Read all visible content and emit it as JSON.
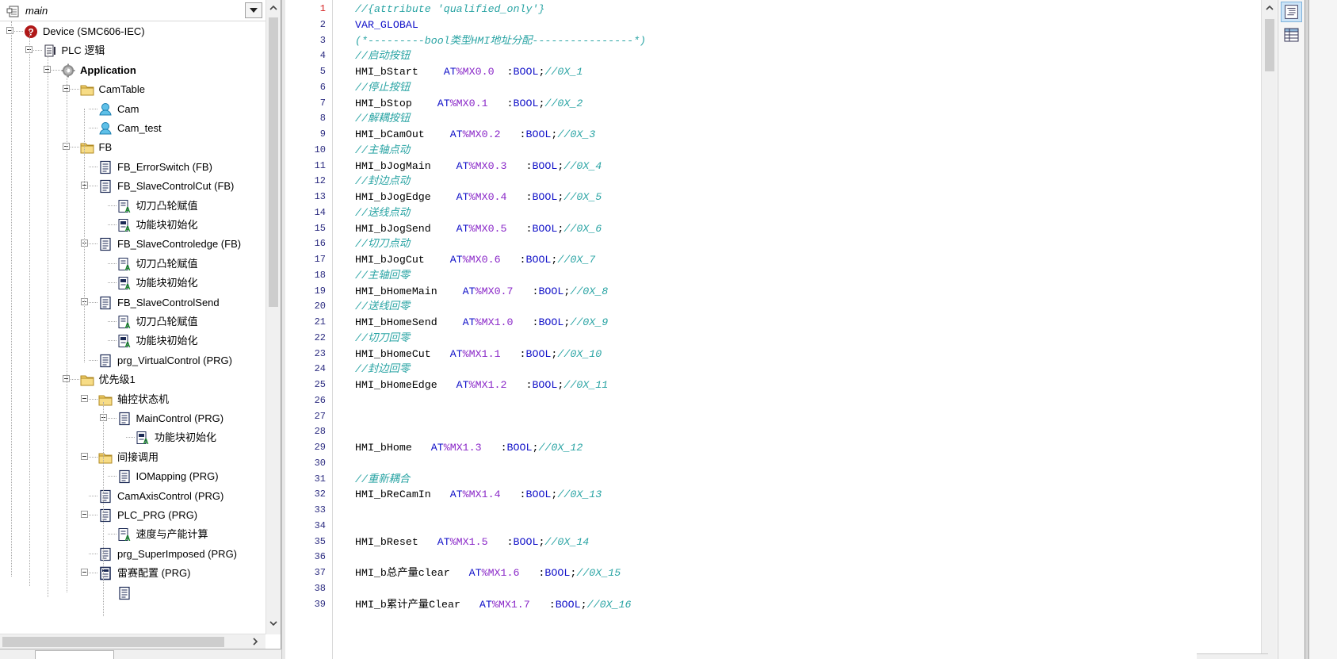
{
  "tree": {
    "root_label": "main",
    "nodes": [
      {
        "label": "Device (SMC606-IEC)",
        "icon": "device-error-icon",
        "expander": true,
        "bold": false
      },
      {
        "label": "PLC 逻辑",
        "icon": "plc-logic-icon",
        "expander": true,
        "bold": false
      },
      {
        "label": "Application",
        "icon": "application-gear-icon",
        "expander": true,
        "bold": true
      },
      {
        "label": "CamTable",
        "icon": "folder-icon",
        "expander": true,
        "bold": false
      },
      {
        "label": "Cam",
        "icon": "cam-icon",
        "expander": false,
        "bold": false
      },
      {
        "label": "Cam_test",
        "icon": "cam-icon",
        "expander": false,
        "bold": false
      },
      {
        "label": "FB",
        "icon": "folder-icon",
        "expander": true,
        "bold": false
      },
      {
        "label": "FB_ErrorSwitch (FB)",
        "icon": "pou-icon",
        "expander": false,
        "bold": false
      },
      {
        "label": "FB_SlaveControlCut (FB)",
        "icon": "pou-icon",
        "expander": true,
        "bold": false
      },
      {
        "label": "切刀凸轮赋值",
        "icon": "action-icon",
        "expander": false,
        "bold": false
      },
      {
        "label": "功能块初始化",
        "icon": "action-init-icon",
        "expander": false,
        "bold": false
      },
      {
        "label": "FB_SlaveControledge (FB)",
        "icon": "pou-icon",
        "expander": true,
        "bold": false
      },
      {
        "label": "切刀凸轮赋值",
        "icon": "action-icon",
        "expander": false,
        "bold": false
      },
      {
        "label": "功能块初始化",
        "icon": "action-init-icon",
        "expander": false,
        "bold": false
      },
      {
        "label": "FB_SlaveControlSend",
        "icon": "pou-icon",
        "expander": true,
        "bold": false
      },
      {
        "label": "切刀凸轮赋值",
        "icon": "action-icon",
        "expander": false,
        "bold": false
      },
      {
        "label": "功能块初始化",
        "icon": "action-init-icon",
        "expander": false,
        "bold": false
      },
      {
        "label": "prg_VirtualControl (PRG)",
        "icon": "pou-icon",
        "expander": false,
        "bold": false
      },
      {
        "label": "优先级1",
        "icon": "folder-icon",
        "expander": true,
        "bold": false
      },
      {
        "label": "轴控状态机",
        "icon": "folder-icon",
        "expander": true,
        "bold": false
      },
      {
        "label": "MainControl (PRG)",
        "icon": "pou-icon",
        "expander": true,
        "bold": false
      },
      {
        "label": "功能块初始化",
        "icon": "action-init-icon",
        "expander": false,
        "bold": false
      },
      {
        "label": "间接调用",
        "icon": "folder-icon",
        "expander": true,
        "bold": false
      },
      {
        "label": "IOMapping (PRG)",
        "icon": "pou-icon",
        "expander": false,
        "bold": false
      },
      {
        "label": "CamAxisControl (PRG)",
        "icon": "pou-icon",
        "expander": false,
        "bold": false
      },
      {
        "label": "PLC_PRG (PRG)",
        "icon": "pou-icon",
        "expander": true,
        "bold": false
      },
      {
        "label": "速度与产能计算",
        "icon": "action-icon",
        "expander": false,
        "bold": false
      },
      {
        "label": "prg_SuperImposed (PRG)",
        "icon": "pou-icon",
        "expander": false,
        "bold": false
      },
      {
        "label": "雷赛配置 (PRG)",
        "icon": "pou-dark-icon",
        "expander": true,
        "bold": false
      }
    ]
  },
  "editor": {
    "active_line": 1,
    "lines": [
      [
        {
          "t": "//{attribute 'qualified_only'}",
          "c": "cmt"
        }
      ],
      [
        {
          "t": "VAR_GLOBAL",
          "c": "kw"
        }
      ],
      [
        {
          "t": "(*---------bool类型HMI地址分配----------------*)",
          "c": "cmt"
        }
      ],
      [
        {
          "t": "//启动按钮",
          "c": "cmt"
        }
      ],
      [
        {
          "t": "HMI_bStart    ",
          "c": "id"
        },
        {
          "t": "AT",
          "c": "kw"
        },
        {
          "t": "%MX0.0",
          "c": "addr"
        },
        {
          "t": "  :",
          "c": "id"
        },
        {
          "t": "BOOL",
          "c": "type"
        },
        {
          "t": ";",
          "c": "id"
        },
        {
          "t": "//0X_1",
          "c": "cmt"
        }
      ],
      [
        {
          "t": "//停止按钮",
          "c": "cmt"
        }
      ],
      [
        {
          "t": "HMI_bStop    ",
          "c": "id"
        },
        {
          "t": "AT",
          "c": "kw"
        },
        {
          "t": "%MX0.1",
          "c": "addr"
        },
        {
          "t": "   :",
          "c": "id"
        },
        {
          "t": "BOOL",
          "c": "type"
        },
        {
          "t": ";",
          "c": "id"
        },
        {
          "t": "//0X_2",
          "c": "cmt"
        }
      ],
      [
        {
          "t": "//解耦按钮",
          "c": "cmt"
        }
      ],
      [
        {
          "t": "HMI_bCamOut    ",
          "c": "id"
        },
        {
          "t": "AT",
          "c": "kw"
        },
        {
          "t": "%MX0.2",
          "c": "addr"
        },
        {
          "t": "   :",
          "c": "id"
        },
        {
          "t": "BOOL",
          "c": "type"
        },
        {
          "t": ";",
          "c": "id"
        },
        {
          "t": "//0X_3",
          "c": "cmt"
        }
      ],
      [
        {
          "t": "//主轴点动",
          "c": "cmt"
        }
      ],
      [
        {
          "t": "HMI_bJogMain    ",
          "c": "id"
        },
        {
          "t": "AT",
          "c": "kw"
        },
        {
          "t": "%MX0.3",
          "c": "addr"
        },
        {
          "t": "   :",
          "c": "id"
        },
        {
          "t": "BOOL",
          "c": "type"
        },
        {
          "t": ";",
          "c": "id"
        },
        {
          "t": "//0X_4",
          "c": "cmt"
        }
      ],
      [
        {
          "t": "//封边点动",
          "c": "cmt"
        }
      ],
      [
        {
          "t": "HMI_bJogEdge    ",
          "c": "id"
        },
        {
          "t": "AT",
          "c": "kw"
        },
        {
          "t": "%MX0.4",
          "c": "addr"
        },
        {
          "t": "   :",
          "c": "id"
        },
        {
          "t": "BOOL",
          "c": "type"
        },
        {
          "t": ";",
          "c": "id"
        },
        {
          "t": "//0X_5",
          "c": "cmt"
        }
      ],
      [
        {
          "t": "//送线点动",
          "c": "cmt"
        }
      ],
      [
        {
          "t": "HMI_bJogSend    ",
          "c": "id"
        },
        {
          "t": "AT",
          "c": "kw"
        },
        {
          "t": "%MX0.5",
          "c": "addr"
        },
        {
          "t": "   :",
          "c": "id"
        },
        {
          "t": "BOOL",
          "c": "type"
        },
        {
          "t": ";",
          "c": "id"
        },
        {
          "t": "//0X_6",
          "c": "cmt"
        }
      ],
      [
        {
          "t": "//切刀点动",
          "c": "cmt"
        }
      ],
      [
        {
          "t": "HMI_bJogCut    ",
          "c": "id"
        },
        {
          "t": "AT",
          "c": "kw"
        },
        {
          "t": "%MX0.6",
          "c": "addr"
        },
        {
          "t": "   :",
          "c": "id"
        },
        {
          "t": "BOOL",
          "c": "type"
        },
        {
          "t": ";",
          "c": "id"
        },
        {
          "t": "//0X_7",
          "c": "cmt"
        }
      ],
      [
        {
          "t": "//主轴回零",
          "c": "cmt"
        }
      ],
      [
        {
          "t": "HMI_bHomeMain    ",
          "c": "id"
        },
        {
          "t": "AT",
          "c": "kw"
        },
        {
          "t": "%MX0.7",
          "c": "addr"
        },
        {
          "t": "   :",
          "c": "id"
        },
        {
          "t": "BOOL",
          "c": "type"
        },
        {
          "t": ";",
          "c": "id"
        },
        {
          "t": "//0X_8",
          "c": "cmt"
        }
      ],
      [
        {
          "t": "//送线回零",
          "c": "cmt"
        }
      ],
      [
        {
          "t": "HMI_bHomeSend    ",
          "c": "id"
        },
        {
          "t": "AT",
          "c": "kw"
        },
        {
          "t": "%MX1.0",
          "c": "addr"
        },
        {
          "t": "   :",
          "c": "id"
        },
        {
          "t": "BOOL",
          "c": "type"
        },
        {
          "t": ";",
          "c": "id"
        },
        {
          "t": "//0X_9",
          "c": "cmt"
        }
      ],
      [
        {
          "t": "//切刀回零",
          "c": "cmt"
        }
      ],
      [
        {
          "t": "HMI_bHomeCut   ",
          "c": "id"
        },
        {
          "t": "AT",
          "c": "kw"
        },
        {
          "t": "%MX1.1",
          "c": "addr"
        },
        {
          "t": "   :",
          "c": "id"
        },
        {
          "t": "BOOL",
          "c": "type"
        },
        {
          "t": ";",
          "c": "id"
        },
        {
          "t": "//0X_10",
          "c": "cmt"
        }
      ],
      [
        {
          "t": "//封边回零",
          "c": "cmt"
        }
      ],
      [
        {
          "t": "HMI_bHomeEdge   ",
          "c": "id"
        },
        {
          "t": "AT",
          "c": "kw"
        },
        {
          "t": "%MX1.2",
          "c": "addr"
        },
        {
          "t": "   :",
          "c": "id"
        },
        {
          "t": "BOOL",
          "c": "type"
        },
        {
          "t": ";",
          "c": "id"
        },
        {
          "t": "//0X_11",
          "c": "cmt"
        }
      ],
      [],
      [],
      [],
      [
        {
          "t": "HMI_bHome   ",
          "c": "id"
        },
        {
          "t": "AT",
          "c": "kw"
        },
        {
          "t": "%MX1.3",
          "c": "addr"
        },
        {
          "t": "   :",
          "c": "id"
        },
        {
          "t": "BOOL",
          "c": "type"
        },
        {
          "t": ";",
          "c": "id"
        },
        {
          "t": "//0X_12",
          "c": "cmt"
        }
      ],
      [],
      [
        {
          "t": "//重新耦合",
          "c": "cmt"
        }
      ],
      [
        {
          "t": "HMI_bReCamIn   ",
          "c": "id"
        },
        {
          "t": "AT",
          "c": "kw"
        },
        {
          "t": "%MX1.4",
          "c": "addr"
        },
        {
          "t": "   :",
          "c": "id"
        },
        {
          "t": "BOOL",
          "c": "type"
        },
        {
          "t": ";",
          "c": "id"
        },
        {
          "t": "//0X_13",
          "c": "cmt"
        }
      ],
      [],
      [],
      [
        {
          "t": "HMI_bReset   ",
          "c": "id"
        },
        {
          "t": "AT",
          "c": "kw"
        },
        {
          "t": "%MX1.5",
          "c": "addr"
        },
        {
          "t": "   :",
          "c": "id"
        },
        {
          "t": "BOOL",
          "c": "type"
        },
        {
          "t": ";",
          "c": "id"
        },
        {
          "t": "//0X_14",
          "c": "cmt"
        }
      ],
      [],
      [
        {
          "t": "HMI_b总产量clear   ",
          "c": "id"
        },
        {
          "t": "AT",
          "c": "kw"
        },
        {
          "t": "%MX1.6",
          "c": "addr"
        },
        {
          "t": "   :",
          "c": "id"
        },
        {
          "t": "BOOL",
          "c": "type"
        },
        {
          "t": ";",
          "c": "id"
        },
        {
          "t": "//0X_15",
          "c": "cmt"
        }
      ],
      [],
      [
        {
          "t": "HMI_b累计产量Clear   ",
          "c": "id"
        },
        {
          "t": "AT",
          "c": "kw"
        },
        {
          "t": "%MX1.7",
          "c": "addr"
        },
        {
          "t": "   :",
          "c": "id"
        },
        {
          "t": "BOOL",
          "c": "type"
        },
        {
          "t": ";",
          "c": "id"
        },
        {
          "t": "//0X_16",
          "c": "cmt"
        }
      ]
    ]
  },
  "colors": {
    "line_number": "#2b2b80",
    "active_line_number": "#d42020",
    "comment": "#2aa4a4",
    "keyword": "#1010c8",
    "address": "#8a28c8",
    "identifier": "#000000"
  }
}
